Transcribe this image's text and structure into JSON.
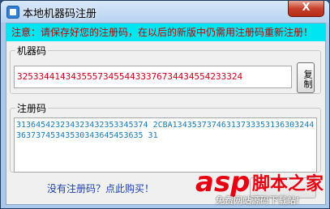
{
  "window": {
    "title": "本地机器码注册",
    "close_label": "X"
  },
  "notice": {
    "text": "注意：请保存好您的注册码，在以后的新版中仍需用注册码重新注册！"
  },
  "machine": {
    "label": "机器码",
    "value": "325334414343555734554433376734434554233324",
    "copy_label": "复制"
  },
  "registration": {
    "label": "注册码",
    "value": "313645423234323432353345374 2CBA1343537374631373335313630324436373745343530343645453635 31"
  },
  "buy_link": "没有注册码？点此购买！",
  "watermark": {
    "logo": "asp",
    "cn": "脚本之家",
    "sub": "免费网站源码下载站!"
  },
  "icons": {
    "app": "app-icon",
    "close": "close-icon"
  },
  "colors": {
    "notice_bg": "#00e5f2",
    "notice_text": "#c00000",
    "machine_text": "#d1001c",
    "reg_text": "#1a7ab5"
  }
}
